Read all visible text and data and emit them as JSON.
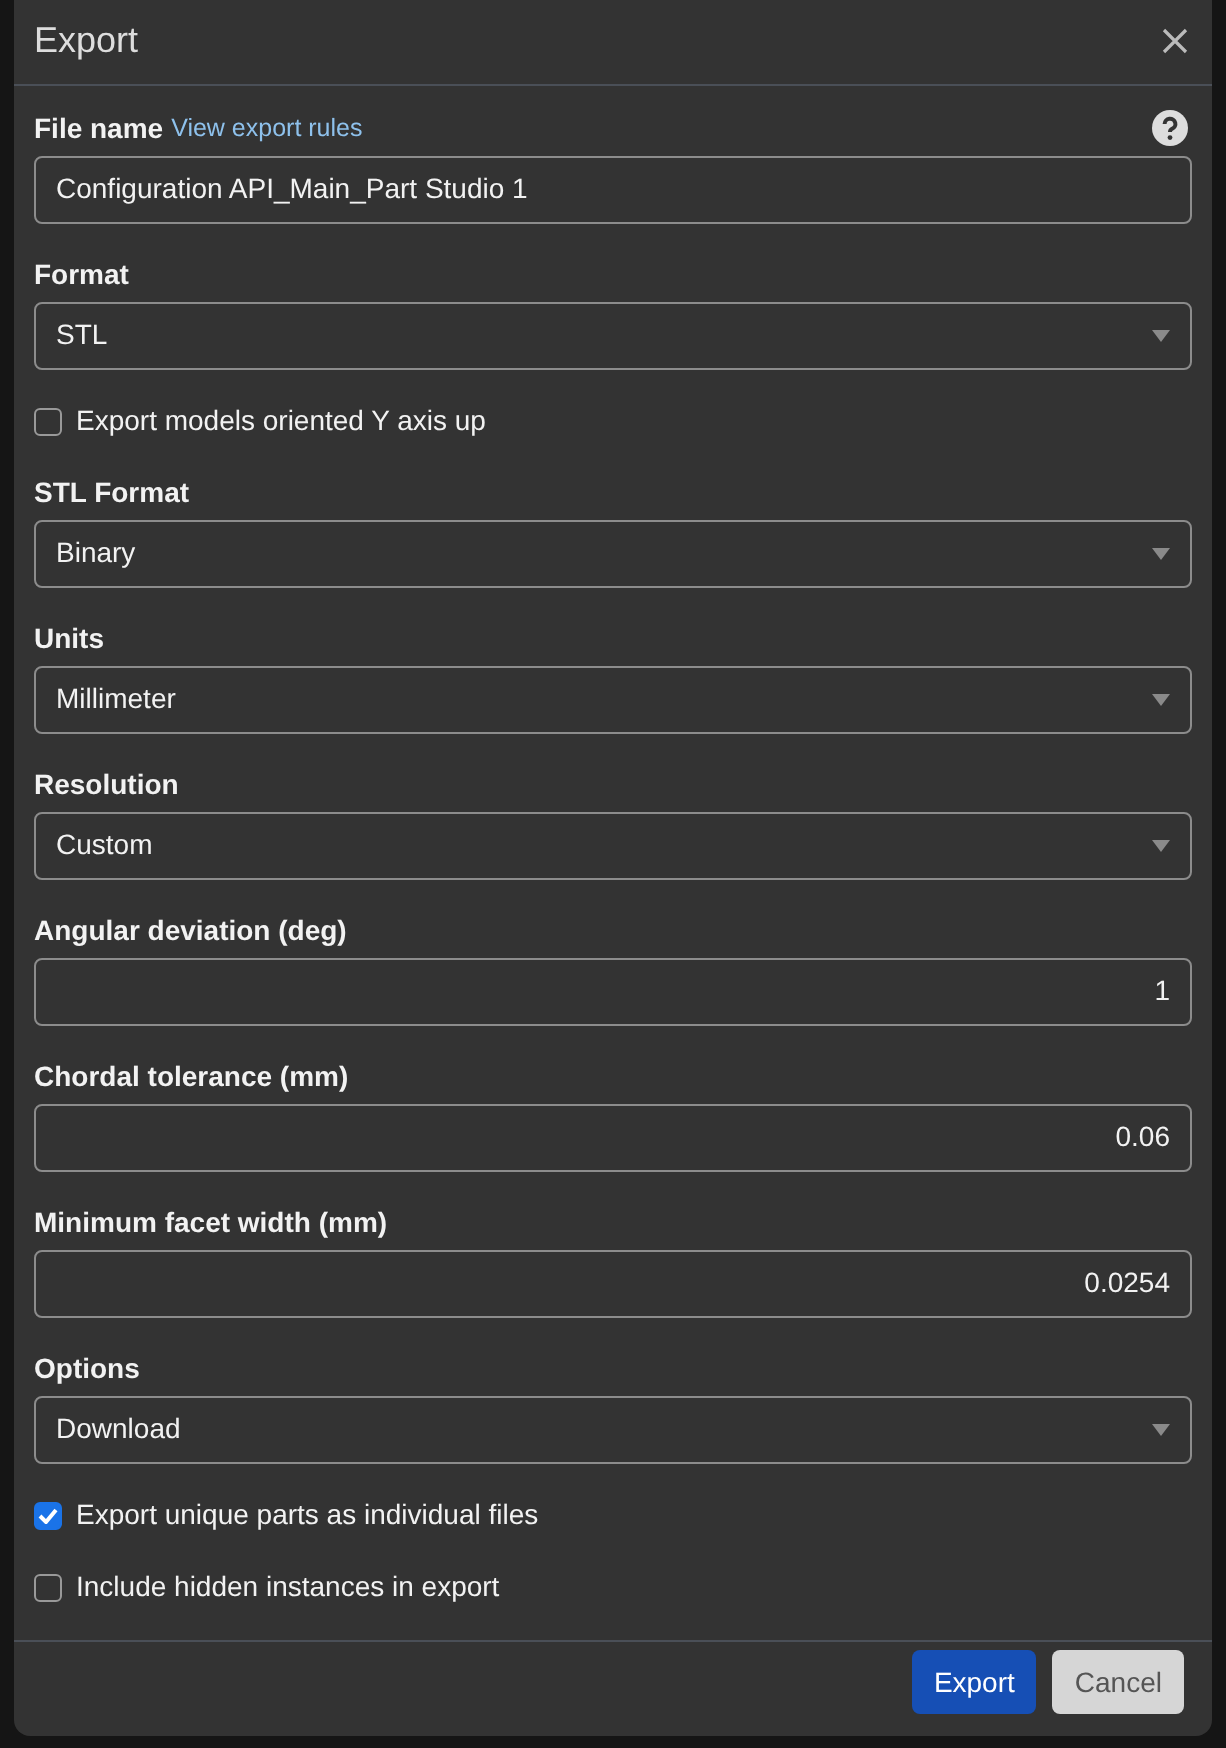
{
  "dialog": {
    "title": "Export"
  },
  "fields": [
    {
      "kind": "text",
      "label": "File name",
      "link": "View export rules",
      "value": "Configuration API_Main_Part Studio 1"
    },
    {
      "kind": "select",
      "label": "Format",
      "value": "STL"
    },
    {
      "kind": "checkbox",
      "label": "Export models oriented Y axis up",
      "checked": false
    },
    {
      "kind": "select",
      "label": "STL Format",
      "value": "Binary"
    },
    {
      "kind": "select",
      "label": "Units",
      "value": "Millimeter"
    },
    {
      "kind": "select",
      "label": "Resolution",
      "value": "Custom"
    },
    {
      "kind": "number",
      "label": "Angular deviation (deg)",
      "value": "1"
    },
    {
      "kind": "number",
      "label": "Chordal tolerance (mm)",
      "value": "0.06"
    },
    {
      "kind": "number",
      "label": "Minimum facet width (mm)",
      "value": "0.0254"
    },
    {
      "kind": "select",
      "label": "Options",
      "value": "Download"
    },
    {
      "kind": "checkbox",
      "label": "Export unique parts as individual files",
      "checked": true
    },
    {
      "kind": "checkbox",
      "label": "Include hidden instances in export",
      "checked": false
    }
  ],
  "buttons": [
    {
      "label": "Export",
      "kind": "primary"
    },
    {
      "label": "Cancel",
      "kind": "secondary"
    }
  ]
}
